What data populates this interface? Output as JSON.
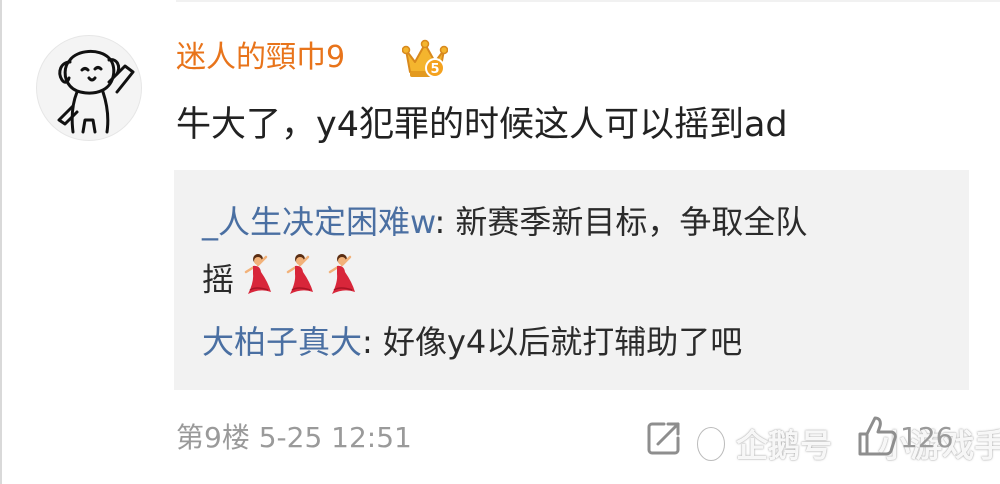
{
  "comment": {
    "username": "迷人的頸巾9",
    "text": "牛大了，y4犯罪的时候这人可以摇到ad",
    "floor": "第9楼",
    "time": "5-25 12:51",
    "like_count": "126",
    "badge_number": "5"
  },
  "replies": [
    {
      "author": "_人生决定困难w",
      "separator": ": ",
      "text_line1": "新赛季新目标，争取全队",
      "text_line2": "摇",
      "emojis": [
        "dancer",
        "dancer",
        "dancer"
      ]
    },
    {
      "author": "大柏子真大",
      "separator": ": ",
      "text": "好像y4以后就打辅助了吧"
    }
  ],
  "watermark": {
    "source": "企鹅号",
    "channel": "小游戏手"
  },
  "colors": {
    "username": "#e8741b",
    "reply_author": "#4a6fa2",
    "meta_text": "#9a9a9a",
    "reply_bg": "#f2f2f2"
  }
}
